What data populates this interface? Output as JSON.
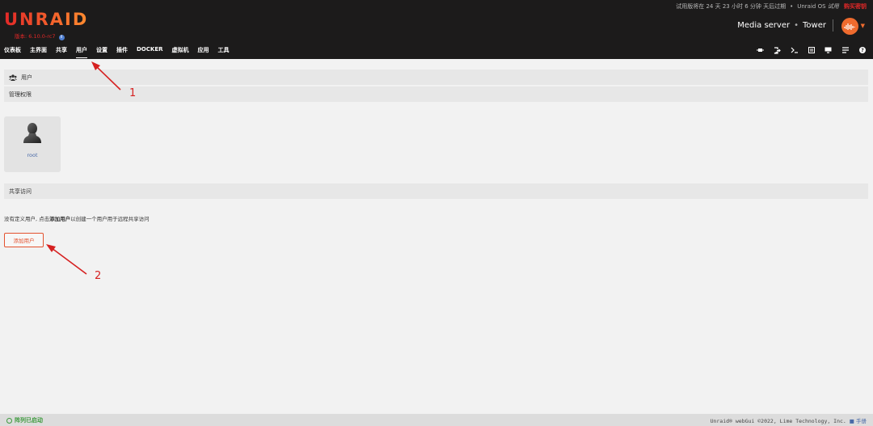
{
  "header": {
    "trial_text": "试用版将在 24 天 23 小时 6 分钟 天后过期",
    "os_name": "Unraid OS",
    "os_edition": "试用",
    "buy_label": "购买密钥",
    "logo": "UNRAID",
    "version": "版本: 6.10.0-rc7",
    "server_description": "Media server",
    "server_name": "Tower"
  },
  "nav": {
    "items": [
      "仪表板",
      "主界面",
      "共享",
      "用户",
      "设置",
      "插件",
      "DOCKER",
      "虚拟机",
      "应用",
      "工具"
    ],
    "active": "用户",
    "icons": [
      "plug-icon",
      "logout-icon",
      "terminal-icon",
      "log-icon",
      "monitor-icon",
      "list-icon",
      "help-icon"
    ]
  },
  "sections": {
    "users_title": "用户",
    "permissions_title": "管理权限",
    "shares_title": "共享访问"
  },
  "users": [
    {
      "name": "root"
    }
  ],
  "shares": {
    "no_users_prefix": "没有定义用户, 点击",
    "no_users_link": "添加用户",
    "no_users_suffix": "以创建一个用户用于远程共享访问",
    "add_user_label": "添加用户"
  },
  "annotations": {
    "label1": "1",
    "label2": "2",
    "color": "#d62121"
  },
  "footer": {
    "array_status": "阵列已启动",
    "copyright": "Unraid® webGui ©2022, Lime Technology, Inc.",
    "manual_label": "手册"
  },
  "colors": {
    "accent": "#e3522f",
    "header_bg": "#1c1b1b",
    "status_ok": "#3d9a3d",
    "link": "#4a6aa8"
  }
}
